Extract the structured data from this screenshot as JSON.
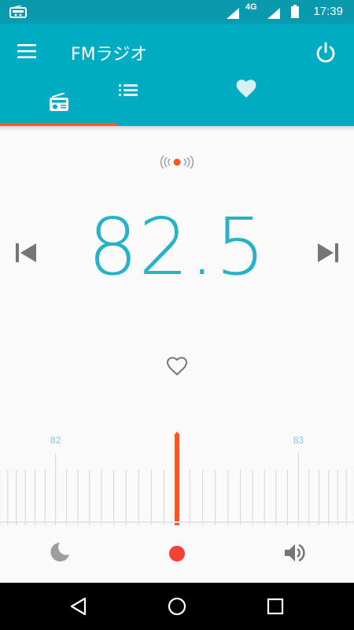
{
  "status_bar": {
    "time": "17:39",
    "network_type": "4G",
    "icons": [
      "radio-notification-icon",
      "signal-icon",
      "signal-icon",
      "battery-icon"
    ]
  },
  "app_bar": {
    "title": "FMラジオ",
    "menu_icon": "menu-icon",
    "power_icon": "power-icon",
    "background_color": "#00acc1"
  },
  "tabs": [
    {
      "name": "radio",
      "icon": "radio-icon",
      "selected": true
    },
    {
      "name": "station-list",
      "icon": "list-icon",
      "selected": false
    },
    {
      "name": "favorites",
      "icon": "heart-icon",
      "selected": false
    }
  ],
  "tab_indicator_color": "#ff5722",
  "player": {
    "frequency": "82.5",
    "frequency_color": "#26b3c6",
    "broadcast_icon": "broadcast-icon",
    "prev_icon": "skip-previous-icon",
    "next_icon": "skip-next-icon",
    "favorite_icon": "heart-outline-icon"
  },
  "dial": {
    "labels": [
      {
        "text": "82",
        "value": 82
      },
      {
        "text": "83",
        "value": 83
      }
    ],
    "current_value": 82.5,
    "needle_color": "#ff5722",
    "label_color": "#7ecbd6"
  },
  "bottom_bar": {
    "sleep_icon": "moon-icon",
    "record_icon": "record-icon",
    "record_color": "#f44336",
    "speaker_icon": "volume-icon"
  },
  "nav_bar": {
    "back_icon": "back-icon",
    "home_icon": "home-icon",
    "recents_icon": "recents-icon"
  }
}
